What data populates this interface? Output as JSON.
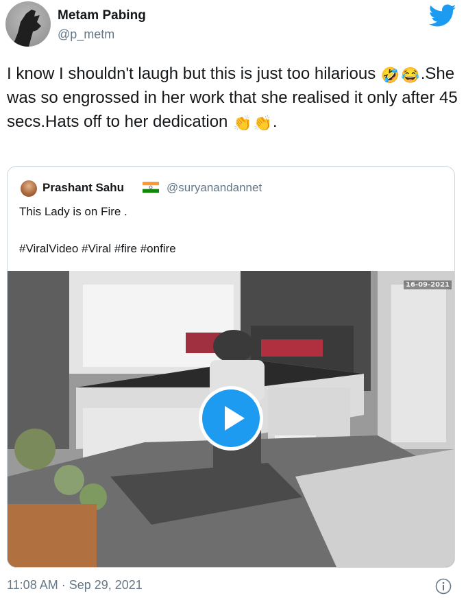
{
  "author": {
    "name": "Metam Pabing",
    "handle": "@p_metm"
  },
  "tweet": {
    "line1": "I know I shouldn't laugh but this is just too hilarious",
    "emoji_laugh_1": "🤣",
    "emoji_laugh_2": "😂",
    "line2_rest": ".She was so engrossed in her work that she realised it only after 45 secs.Hats off to her dedication",
    "emoji_clap_1": "👏",
    "emoji_clap_2": "👏",
    "trailing": "."
  },
  "quoted_tweet": {
    "name": "Prashant Sahu",
    "handle": "@suryanandannet",
    "flag_icon": "india-flag",
    "text": "This Lady is on Fire .",
    "hashtags": "#ViralVideo #Viral #fire #onfire",
    "video": {
      "date_overlay": "16-09-2021",
      "play_icon": "play-icon"
    }
  },
  "footer": {
    "timestamp": "11:08 AM · Sep 29, 2021",
    "info_icon": "info-icon"
  },
  "colors": {
    "twitter_blue": "#1d9bf0",
    "secondary_text": "#657786",
    "border": "#ccd6dd"
  }
}
